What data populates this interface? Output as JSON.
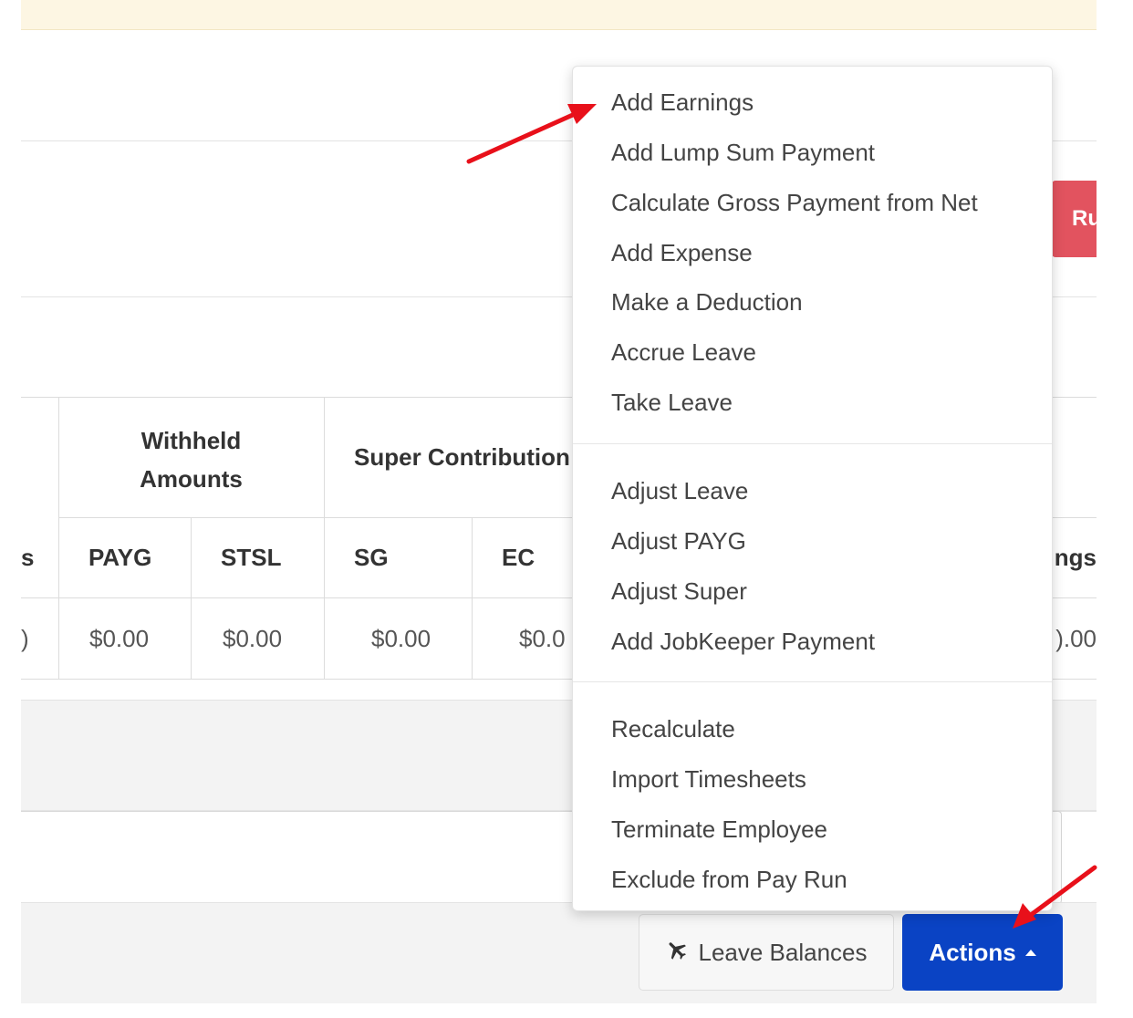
{
  "header": {
    "pay_run_button_label": "Ru"
  },
  "table": {
    "group_headers": {
      "withheld_line1": "Withheld",
      "withheld_line2": "Amounts",
      "super": "Super Contribution"
    },
    "columns": {
      "left_partial": "s",
      "payg": "PAYG",
      "stsl": "STSL",
      "sg": "SG",
      "ec": "EC",
      "right_partial": "ings"
    },
    "row": {
      "left_partial": ")",
      "payg": "$0.00",
      "stsl": "$0.00",
      "sg": "$0.00",
      "ec": "$0.0",
      "right_partial": ").00"
    }
  },
  "menu": {
    "group1": [
      "Add Earnings",
      "Add Lump Sum Payment",
      "Calculate Gross Payment from Net",
      "Add Expense",
      "Make a Deduction",
      "Accrue Leave",
      "Take Leave"
    ],
    "group2": [
      "Adjust Leave",
      "Adjust PAYG",
      "Adjust Super",
      "Add JobKeeper Payment"
    ],
    "group3": [
      "Recalculate",
      "Import Timesheets",
      "Terminate Employee",
      "Exclude from Pay Run"
    ]
  },
  "footer": {
    "leave_balances_label": "Leave Balances",
    "actions_label": "Actions"
  },
  "colors": {
    "actions_blue": "#0a43c4",
    "pay_run_red": "#e2535f",
    "annotation_red": "#e8101a",
    "banner_yellow": "#fdf6e3"
  },
  "icons": {
    "leave_balances": "plane-icon",
    "actions": "caret-up-icon"
  }
}
